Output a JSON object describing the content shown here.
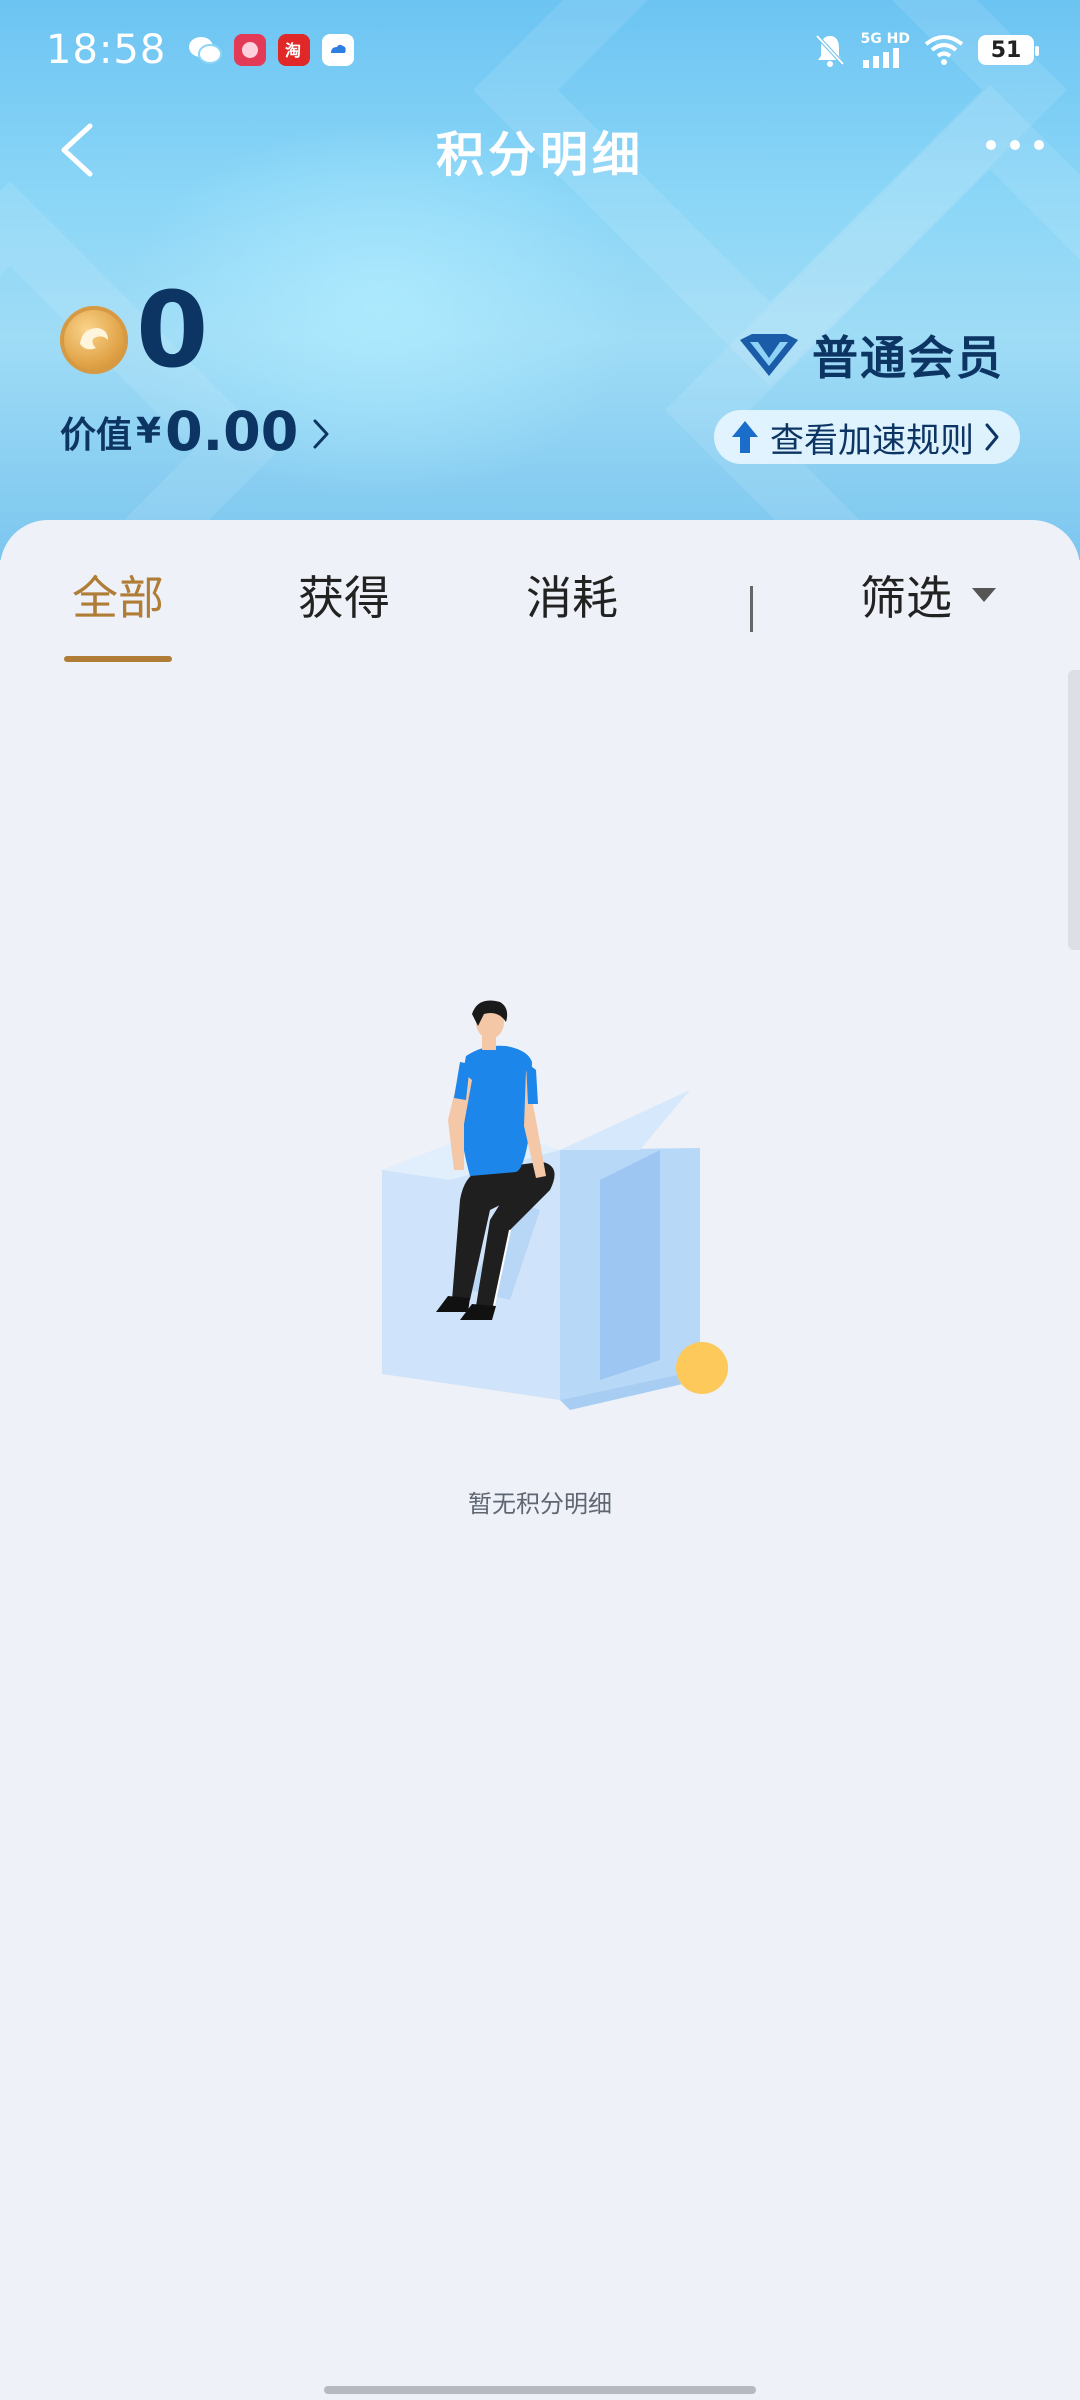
{
  "status_bar": {
    "time": "18:58",
    "battery": "51",
    "network": "5G HD",
    "icons": [
      "wechat-icon",
      "app-red-icon",
      "taobao-icon",
      "app-cloud-icon",
      "mute-bell-icon",
      "signal-icon",
      "wifi-icon",
      "battery-icon"
    ]
  },
  "nav": {
    "title": "积分明细",
    "back_icon": "chevron-left-icon",
    "more_icon": "more-dots-icon"
  },
  "points": {
    "value": "0",
    "value_label": "价值",
    "currency": "¥",
    "amount": "0.00"
  },
  "member": {
    "level": "普通会员",
    "speed_rules": "查看加速规则"
  },
  "tabs": [
    {
      "label": "全部",
      "active": true
    },
    {
      "label": "获得",
      "active": false
    },
    {
      "label": "消耗",
      "active": false
    }
  ],
  "filter": {
    "label": "筛选"
  },
  "empty": {
    "text": "暂无积分明细"
  },
  "colors": {
    "accent_tab": "#b07d37",
    "title_dark": "#0d3563",
    "header_light": "#9fdcf6",
    "background": "#eef1f7"
  }
}
